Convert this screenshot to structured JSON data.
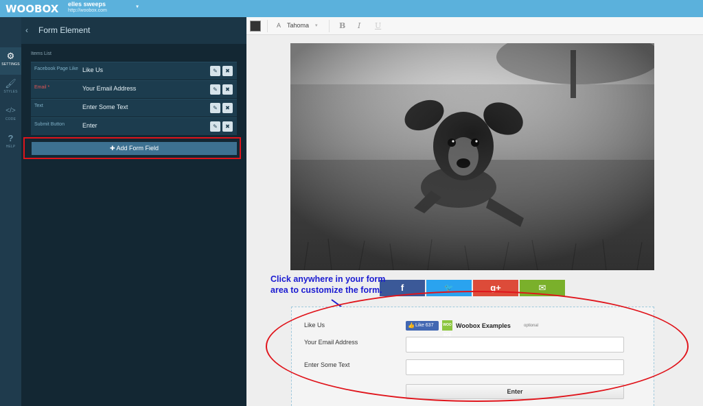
{
  "topbar": {
    "logo": "WOOBOX",
    "account_name": "elles sweeps",
    "account_url": "http://woobox.com",
    "caret": "▾"
  },
  "rail": {
    "items": [
      {
        "label": "SETTINGS",
        "glyph": "⚙"
      },
      {
        "label": "STYLES",
        "glyph": "🖌"
      },
      {
        "label": "CODE",
        "glyph": "</>"
      },
      {
        "label": "HELP",
        "glyph": "?"
      }
    ]
  },
  "panel": {
    "back": "‹",
    "title": "Form Element",
    "items_label": "Items List",
    "items": [
      {
        "key": "Facebook Page Like",
        "value": "Like Us",
        "required": false
      },
      {
        "key": "Email *",
        "value": "Your Email Address",
        "required": true
      },
      {
        "key": "Text",
        "value": "Enter Some Text",
        "required": false
      },
      {
        "key": "Submit Button",
        "value": "Enter",
        "required": false
      }
    ],
    "edit_glyph": "✎",
    "delete_glyph": "✖",
    "add_button": "✚ Add Form Field"
  },
  "toolbar": {
    "font_icon": "A",
    "font_name": "Tahoma",
    "font_caret": "▾",
    "bold": "B",
    "italic": "I",
    "underline": "U"
  },
  "share": [
    {
      "name": "facebook",
      "glyph": "f",
      "color": "#3b5998"
    },
    {
      "name": "twitter",
      "glyph": "🐦",
      "color": "#2aa3ef"
    },
    {
      "name": "google-plus",
      "glyph": "g+",
      "color": "#dd4b39"
    },
    {
      "name": "email",
      "glyph": "✉",
      "color": "#7ab02b"
    }
  ],
  "callout": "Click anywhere in your form area to customize the form.",
  "form": {
    "like_label": "Like Us",
    "like_chip": "Like 637",
    "like_thumb": "👍",
    "brand_logo": "WOO BOX",
    "brand_name": "Woobox Examples",
    "optional": "optional",
    "email_label": "Your Email Address",
    "text_label": "Enter Some Text",
    "submit": "Enter"
  },
  "colors": {
    "topbar": "#5bb1dc",
    "panel": "#132733",
    "highlight": "#e0141b",
    "callout": "#1a1ad1"
  }
}
